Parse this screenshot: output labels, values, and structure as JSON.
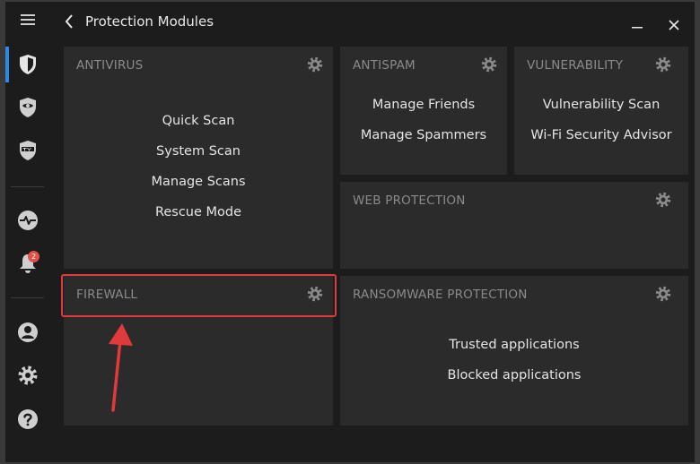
{
  "window": {
    "title": "Protection Modules"
  },
  "sidebar": {
    "items": [
      {
        "icon": "menu-icon"
      },
      {
        "icon": "shield-icon",
        "active": true
      },
      {
        "icon": "eye-shield-icon"
      },
      {
        "icon": "ty-shield-icon"
      },
      {
        "icon": "activity-icon"
      },
      {
        "icon": "bell-icon",
        "badge": "2"
      },
      {
        "icon": "user-icon"
      },
      {
        "icon": "gear-icon"
      },
      {
        "icon": "help-icon"
      }
    ]
  },
  "panels": {
    "antivirus": {
      "title": "ANTIVIRUS",
      "links": [
        "Quick Scan",
        "System Scan",
        "Manage Scans",
        "Rescue Mode"
      ]
    },
    "antispam": {
      "title": "ANTISPAM",
      "links": [
        "Manage Friends",
        "Manage Spammers"
      ]
    },
    "vulnerability": {
      "title": "VULNERABILITY",
      "links": [
        "Vulnerability Scan",
        "Wi-Fi Security Advisor"
      ]
    },
    "web_protection": {
      "title": "WEB PROTECTION",
      "links": []
    },
    "firewall": {
      "title": "FIREWALL",
      "links": []
    },
    "ransomware": {
      "title": "RANSOMWARE PROTECTION",
      "links": [
        "Trusted applications",
        "Blocked applications"
      ]
    }
  },
  "colors": {
    "accent": "#2e88e6",
    "panel": "#2b2b2b",
    "background": "#1c1c1c",
    "annotation": "#e03a3a",
    "badge": "#e25148"
  }
}
